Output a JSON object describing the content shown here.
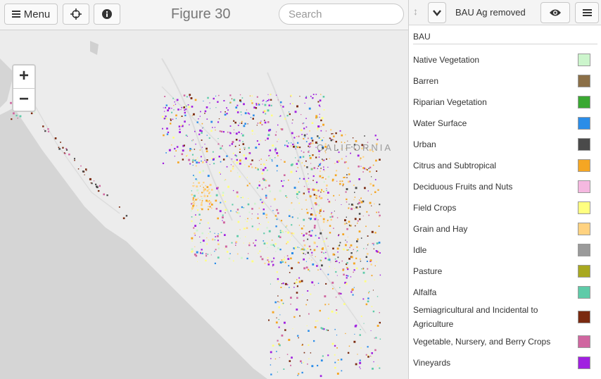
{
  "toolbar": {
    "menu_label": "Menu",
    "figure_title": "Figure 30",
    "search_placeholder": "Search"
  },
  "map": {
    "state_label": "CALIFORNIA",
    "zoom_in": "+",
    "zoom_out": "−"
  },
  "panel": {
    "layer_name": "BAU Ag removed",
    "section_title": "BAU",
    "legend": [
      {
        "label": "Native Vegetation",
        "color": "#ccf5cc"
      },
      {
        "label": "Barren",
        "color": "#8b6f47"
      },
      {
        "label": "Riparian Vegetation",
        "color": "#3aa832"
      },
      {
        "label": "Water Surface",
        "color": "#2b8de8"
      },
      {
        "label": "Urban",
        "color": "#4a4a4a"
      },
      {
        "label": "Citrus and Subtropical",
        "color": "#f5a623"
      },
      {
        "label": "Deciduous Fruits and Nuts",
        "color": "#f5b8e0"
      },
      {
        "label": "Field Crops",
        "color": "#ffff80"
      },
      {
        "label": "Grain and Hay",
        "color": "#ffd280"
      },
      {
        "label": "Idle",
        "color": "#9a9a9a"
      },
      {
        "label": "Pasture",
        "color": "#a8a820"
      },
      {
        "label": "Alfalfa",
        "color": "#5ecba8"
      },
      {
        "label": "Semiagricultural and Incidental to Agriculture",
        "color": "#7a2a10"
      },
      {
        "label": "Vegetable, Nursery, and Berry Crops",
        "color": "#d066a0"
      },
      {
        "label": "Vineyards",
        "color": "#a020e0"
      }
    ]
  }
}
